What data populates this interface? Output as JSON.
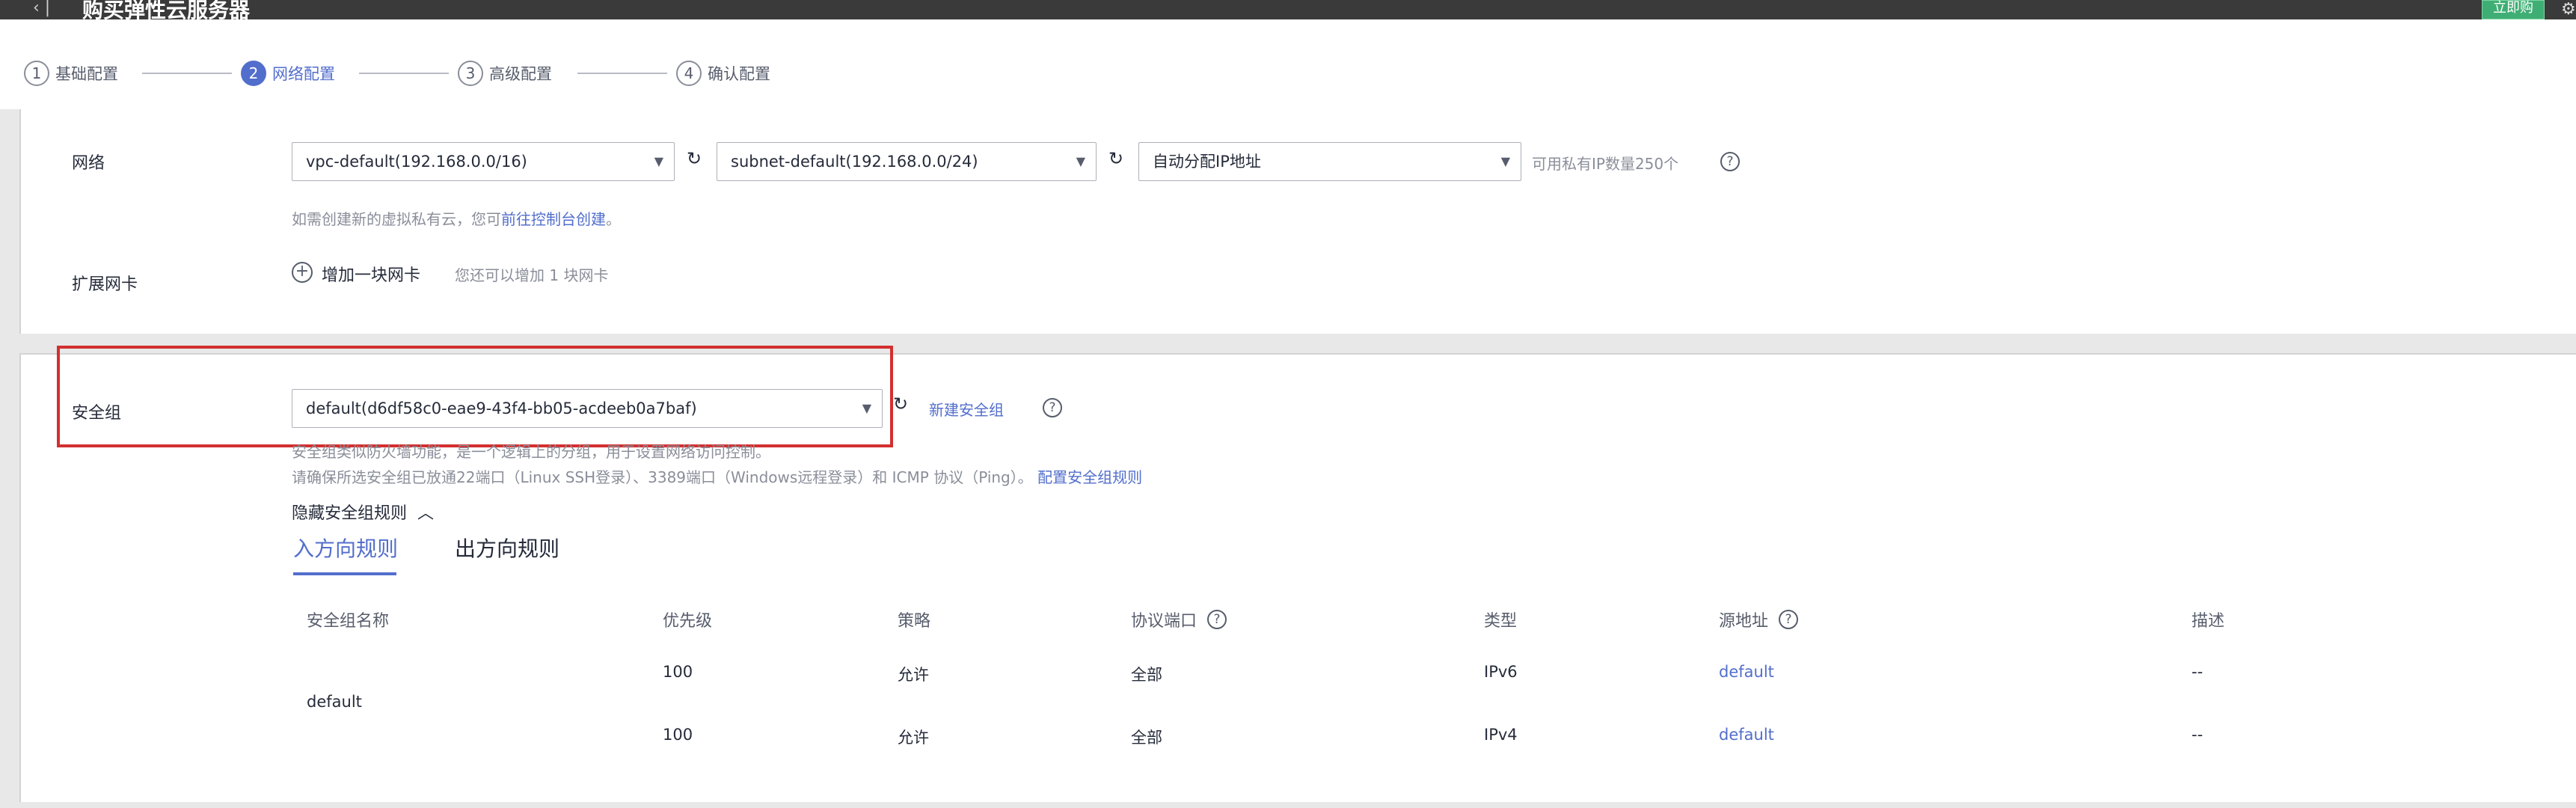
{
  "header": {
    "back_icon": "chevron-left-icon",
    "title": "购买弹性云服务器",
    "right_button": "立即购"
  },
  "steps": [
    {
      "num": "1",
      "label": "基础配置"
    },
    {
      "num": "2",
      "label": "网络配置"
    },
    {
      "num": "3",
      "label": "高级配置"
    },
    {
      "num": "4",
      "label": "确认配置"
    }
  ],
  "network": {
    "label": "网络",
    "vpc": "vpc-default(192.168.0.0/16)",
    "subnet": "subnet-default(192.168.0.0/24)",
    "ip_mode": "自动分配IP地址",
    "ip_available": "可用私有IP数量250个",
    "hint_prefix": "如需创建新的虚拟私有云，您可",
    "hint_link": "前往控制台创建",
    "hint_suffix": "。"
  },
  "nic": {
    "label": "扩展网卡",
    "add_label": "增加一块网卡",
    "hint": "您还可以增加 1 块网卡"
  },
  "security_group": {
    "label": "安全组",
    "selected": "default(d6df58c0-eae9-43f4-bb05-acdeeb0a7baf)",
    "create_link": "新建安全组",
    "desc_line1": "安全组类似防火墙功能，是一个逻辑上的分组，用于设置网络访问控制。",
    "desc_line2_prefix": "请确保所选安全组已放通22端口（Linux SSH登录）、3389端口（Windows远程登录）和 ICMP 协议（Ping）。",
    "desc_line2_link": "配置安全组规则",
    "toggle": "隐藏安全组规则"
  },
  "rules": {
    "tabs": [
      "入方向规则",
      "出方向规则"
    ],
    "columns": [
      "安全组名称",
      "优先级",
      "策略",
      "协议端口",
      "类型",
      "源地址",
      "描述"
    ],
    "group_name": "default",
    "rows": [
      {
        "priority": "100",
        "policy": "允许",
        "port": "全部",
        "type": "IPv6",
        "source": "default",
        "desc": "--"
      },
      {
        "priority": "100",
        "policy": "允许",
        "port": "全部",
        "type": "IPv4",
        "source": "default",
        "desc": "--"
      }
    ]
  },
  "colors": {
    "accent": "#526ecc",
    "highlight_box": "#d32f2f",
    "topbar": "#3a3a3a"
  }
}
